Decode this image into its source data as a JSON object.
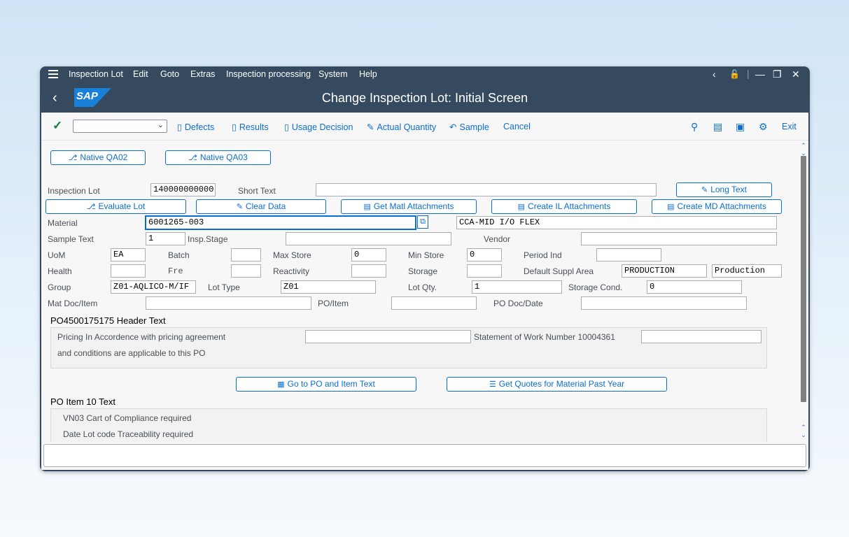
{
  "menubar": {
    "items": [
      "Inspection Lot",
      "Edit",
      "Goto",
      "Extras",
      "Inspection processing",
      "System",
      "Help"
    ]
  },
  "titlebar": {
    "title": "Change Inspection Lot: Initial Screen",
    "logo_text": "SAP"
  },
  "toolbar": {
    "buttons": [
      "Defects",
      "Results",
      "Usage Decision",
      "Actual Quantity",
      "Sample",
      "Cancel"
    ],
    "exit_label": "Exit",
    "dropdown_value": ""
  },
  "nav_buttons": {
    "qa02": "Native QA02",
    "qa03": "Native QA03"
  },
  "inspection_lot": {
    "label": "Inspection Lot",
    "value": "140000000000"
  },
  "short_text": {
    "label": "Short Text",
    "value": ""
  },
  "long_text_button": "Long Text",
  "action_buttons": {
    "evaluate_lot": "Evaluate Lot",
    "clear_data": "Clear Data",
    "get_matl_attachments": "Get Matl Attachments",
    "create_il_attachments": "Create IL Attachments",
    "create_md_attachments": "Create MD Attachments"
  },
  "material": {
    "label": "Material",
    "value": "6001265-003",
    "description": "CCA-MID I/O FLEX"
  },
  "sample_text": {
    "label": "Sample Text",
    "value": "1"
  },
  "insp_stage": {
    "label": "Insp.Stage",
    "value": ""
  },
  "vendor": {
    "label": "Vendor",
    "value": ""
  },
  "uom": {
    "label": "UoM",
    "value": "EA"
  },
  "batch": {
    "label": "Batch",
    "value": ""
  },
  "max_store": {
    "label": "Max Store",
    "value": "0"
  },
  "min_store": {
    "label": "Min Store",
    "value": "0"
  },
  "period_ind": {
    "label": "Period Ind",
    "value": ""
  },
  "health": {
    "label": "Health",
    "value": ""
  },
  "fre": {
    "label": "Fre",
    "value": ""
  },
  "reactivity": {
    "label": "Reactivity",
    "value": ""
  },
  "storage": {
    "label": "Storage",
    "value": ""
  },
  "default_suppl_area": {
    "label": "Default Suppl Area",
    "value": "PRODUCTION",
    "value2": "Production"
  },
  "group": {
    "label": "Group",
    "value": "Z01-AQLICO-M/IF"
  },
  "lot_type": {
    "label": "Lot Type",
    "value": "Z01"
  },
  "lot_qty": {
    "label": "Lot Qty.",
    "value": "1"
  },
  "storage_cond": {
    "label": "Storage Cond.",
    "value": "0"
  },
  "mat_doc_item": {
    "label": "Mat Doc/Item",
    "value": ""
  },
  "po_item": {
    "label": "PO/Item",
    "value": ""
  },
  "po_doc_date": {
    "label": "PO Doc/Date",
    "value": ""
  },
  "po_header": {
    "title": "PO4500175175 Header Text",
    "line1": "Pricing In Accordence with pricing agreement",
    "line2": "Statement of Work Number 10004361",
    "line3": "and conditions are applicable to this PO"
  },
  "po_buttons": {
    "go_to_po": "Go to PO and Item Text",
    "get_quotes": "Get Quotes for Material Past Year"
  },
  "po_item_text": {
    "title": "PO Item 10 Text",
    "line1": "VN03 Cart of Compliance required",
    "line2": "Date Lot code Traceability required"
  },
  "colors": {
    "shell": "#354a5f",
    "accent": "#0a6ed1",
    "ok": "#107e3e"
  }
}
